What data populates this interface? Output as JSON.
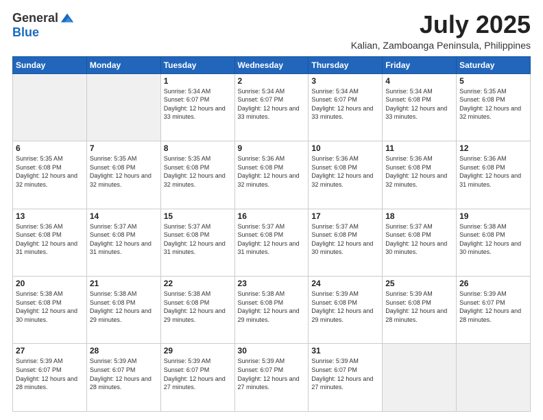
{
  "header": {
    "logo_general": "General",
    "logo_blue": "Blue",
    "month_title": "July 2025",
    "location": "Kalian, Zamboanga Peninsula, Philippines"
  },
  "weekdays": [
    "Sunday",
    "Monday",
    "Tuesday",
    "Wednesday",
    "Thursday",
    "Friday",
    "Saturday"
  ],
  "weeks": [
    [
      {
        "day": "",
        "sunrise": "",
        "sunset": "",
        "daylight": ""
      },
      {
        "day": "",
        "sunrise": "",
        "sunset": "",
        "daylight": ""
      },
      {
        "day": "1",
        "sunrise": "Sunrise: 5:34 AM",
        "sunset": "Sunset: 6:07 PM",
        "daylight": "Daylight: 12 hours and 33 minutes."
      },
      {
        "day": "2",
        "sunrise": "Sunrise: 5:34 AM",
        "sunset": "Sunset: 6:07 PM",
        "daylight": "Daylight: 12 hours and 33 minutes."
      },
      {
        "day": "3",
        "sunrise": "Sunrise: 5:34 AM",
        "sunset": "Sunset: 6:07 PM",
        "daylight": "Daylight: 12 hours and 33 minutes."
      },
      {
        "day": "4",
        "sunrise": "Sunrise: 5:34 AM",
        "sunset": "Sunset: 6:08 PM",
        "daylight": "Daylight: 12 hours and 33 minutes."
      },
      {
        "day": "5",
        "sunrise": "Sunrise: 5:35 AM",
        "sunset": "Sunset: 6:08 PM",
        "daylight": "Daylight: 12 hours and 32 minutes."
      }
    ],
    [
      {
        "day": "6",
        "sunrise": "Sunrise: 5:35 AM",
        "sunset": "Sunset: 6:08 PM",
        "daylight": "Daylight: 12 hours and 32 minutes."
      },
      {
        "day": "7",
        "sunrise": "Sunrise: 5:35 AM",
        "sunset": "Sunset: 6:08 PM",
        "daylight": "Daylight: 12 hours and 32 minutes."
      },
      {
        "day": "8",
        "sunrise": "Sunrise: 5:35 AM",
        "sunset": "Sunset: 6:08 PM",
        "daylight": "Daylight: 12 hours and 32 minutes."
      },
      {
        "day": "9",
        "sunrise": "Sunrise: 5:36 AM",
        "sunset": "Sunset: 6:08 PM",
        "daylight": "Daylight: 12 hours and 32 minutes."
      },
      {
        "day": "10",
        "sunrise": "Sunrise: 5:36 AM",
        "sunset": "Sunset: 6:08 PM",
        "daylight": "Daylight: 12 hours and 32 minutes."
      },
      {
        "day": "11",
        "sunrise": "Sunrise: 5:36 AM",
        "sunset": "Sunset: 6:08 PM",
        "daylight": "Daylight: 12 hours and 32 minutes."
      },
      {
        "day": "12",
        "sunrise": "Sunrise: 5:36 AM",
        "sunset": "Sunset: 6:08 PM",
        "daylight": "Daylight: 12 hours and 31 minutes."
      }
    ],
    [
      {
        "day": "13",
        "sunrise": "Sunrise: 5:36 AM",
        "sunset": "Sunset: 6:08 PM",
        "daylight": "Daylight: 12 hours and 31 minutes."
      },
      {
        "day": "14",
        "sunrise": "Sunrise: 5:37 AM",
        "sunset": "Sunset: 6:08 PM",
        "daylight": "Daylight: 12 hours and 31 minutes."
      },
      {
        "day": "15",
        "sunrise": "Sunrise: 5:37 AM",
        "sunset": "Sunset: 6:08 PM",
        "daylight": "Daylight: 12 hours and 31 minutes."
      },
      {
        "day": "16",
        "sunrise": "Sunrise: 5:37 AM",
        "sunset": "Sunset: 6:08 PM",
        "daylight": "Daylight: 12 hours and 31 minutes."
      },
      {
        "day": "17",
        "sunrise": "Sunrise: 5:37 AM",
        "sunset": "Sunset: 6:08 PM",
        "daylight": "Daylight: 12 hours and 30 minutes."
      },
      {
        "day": "18",
        "sunrise": "Sunrise: 5:37 AM",
        "sunset": "Sunset: 6:08 PM",
        "daylight": "Daylight: 12 hours and 30 minutes."
      },
      {
        "day": "19",
        "sunrise": "Sunrise: 5:38 AM",
        "sunset": "Sunset: 6:08 PM",
        "daylight": "Daylight: 12 hours and 30 minutes."
      }
    ],
    [
      {
        "day": "20",
        "sunrise": "Sunrise: 5:38 AM",
        "sunset": "Sunset: 6:08 PM",
        "daylight": "Daylight: 12 hours and 30 minutes."
      },
      {
        "day": "21",
        "sunrise": "Sunrise: 5:38 AM",
        "sunset": "Sunset: 6:08 PM",
        "daylight": "Daylight: 12 hours and 29 minutes."
      },
      {
        "day": "22",
        "sunrise": "Sunrise: 5:38 AM",
        "sunset": "Sunset: 6:08 PM",
        "daylight": "Daylight: 12 hours and 29 minutes."
      },
      {
        "day": "23",
        "sunrise": "Sunrise: 5:38 AM",
        "sunset": "Sunset: 6:08 PM",
        "daylight": "Daylight: 12 hours and 29 minutes."
      },
      {
        "day": "24",
        "sunrise": "Sunrise: 5:39 AM",
        "sunset": "Sunset: 6:08 PM",
        "daylight": "Daylight: 12 hours and 29 minutes."
      },
      {
        "day": "25",
        "sunrise": "Sunrise: 5:39 AM",
        "sunset": "Sunset: 6:08 PM",
        "daylight": "Daylight: 12 hours and 28 minutes."
      },
      {
        "day": "26",
        "sunrise": "Sunrise: 5:39 AM",
        "sunset": "Sunset: 6:07 PM",
        "daylight": "Daylight: 12 hours and 28 minutes."
      }
    ],
    [
      {
        "day": "27",
        "sunrise": "Sunrise: 5:39 AM",
        "sunset": "Sunset: 6:07 PM",
        "daylight": "Daylight: 12 hours and 28 minutes."
      },
      {
        "day": "28",
        "sunrise": "Sunrise: 5:39 AM",
        "sunset": "Sunset: 6:07 PM",
        "daylight": "Daylight: 12 hours and 28 minutes."
      },
      {
        "day": "29",
        "sunrise": "Sunrise: 5:39 AM",
        "sunset": "Sunset: 6:07 PM",
        "daylight": "Daylight: 12 hours and 27 minutes."
      },
      {
        "day": "30",
        "sunrise": "Sunrise: 5:39 AM",
        "sunset": "Sunset: 6:07 PM",
        "daylight": "Daylight: 12 hours and 27 minutes."
      },
      {
        "day": "31",
        "sunrise": "Sunrise: 5:39 AM",
        "sunset": "Sunset: 6:07 PM",
        "daylight": "Daylight: 12 hours and 27 minutes."
      },
      {
        "day": "",
        "sunrise": "",
        "sunset": "",
        "daylight": ""
      },
      {
        "day": "",
        "sunrise": "",
        "sunset": "",
        "daylight": ""
      }
    ]
  ]
}
